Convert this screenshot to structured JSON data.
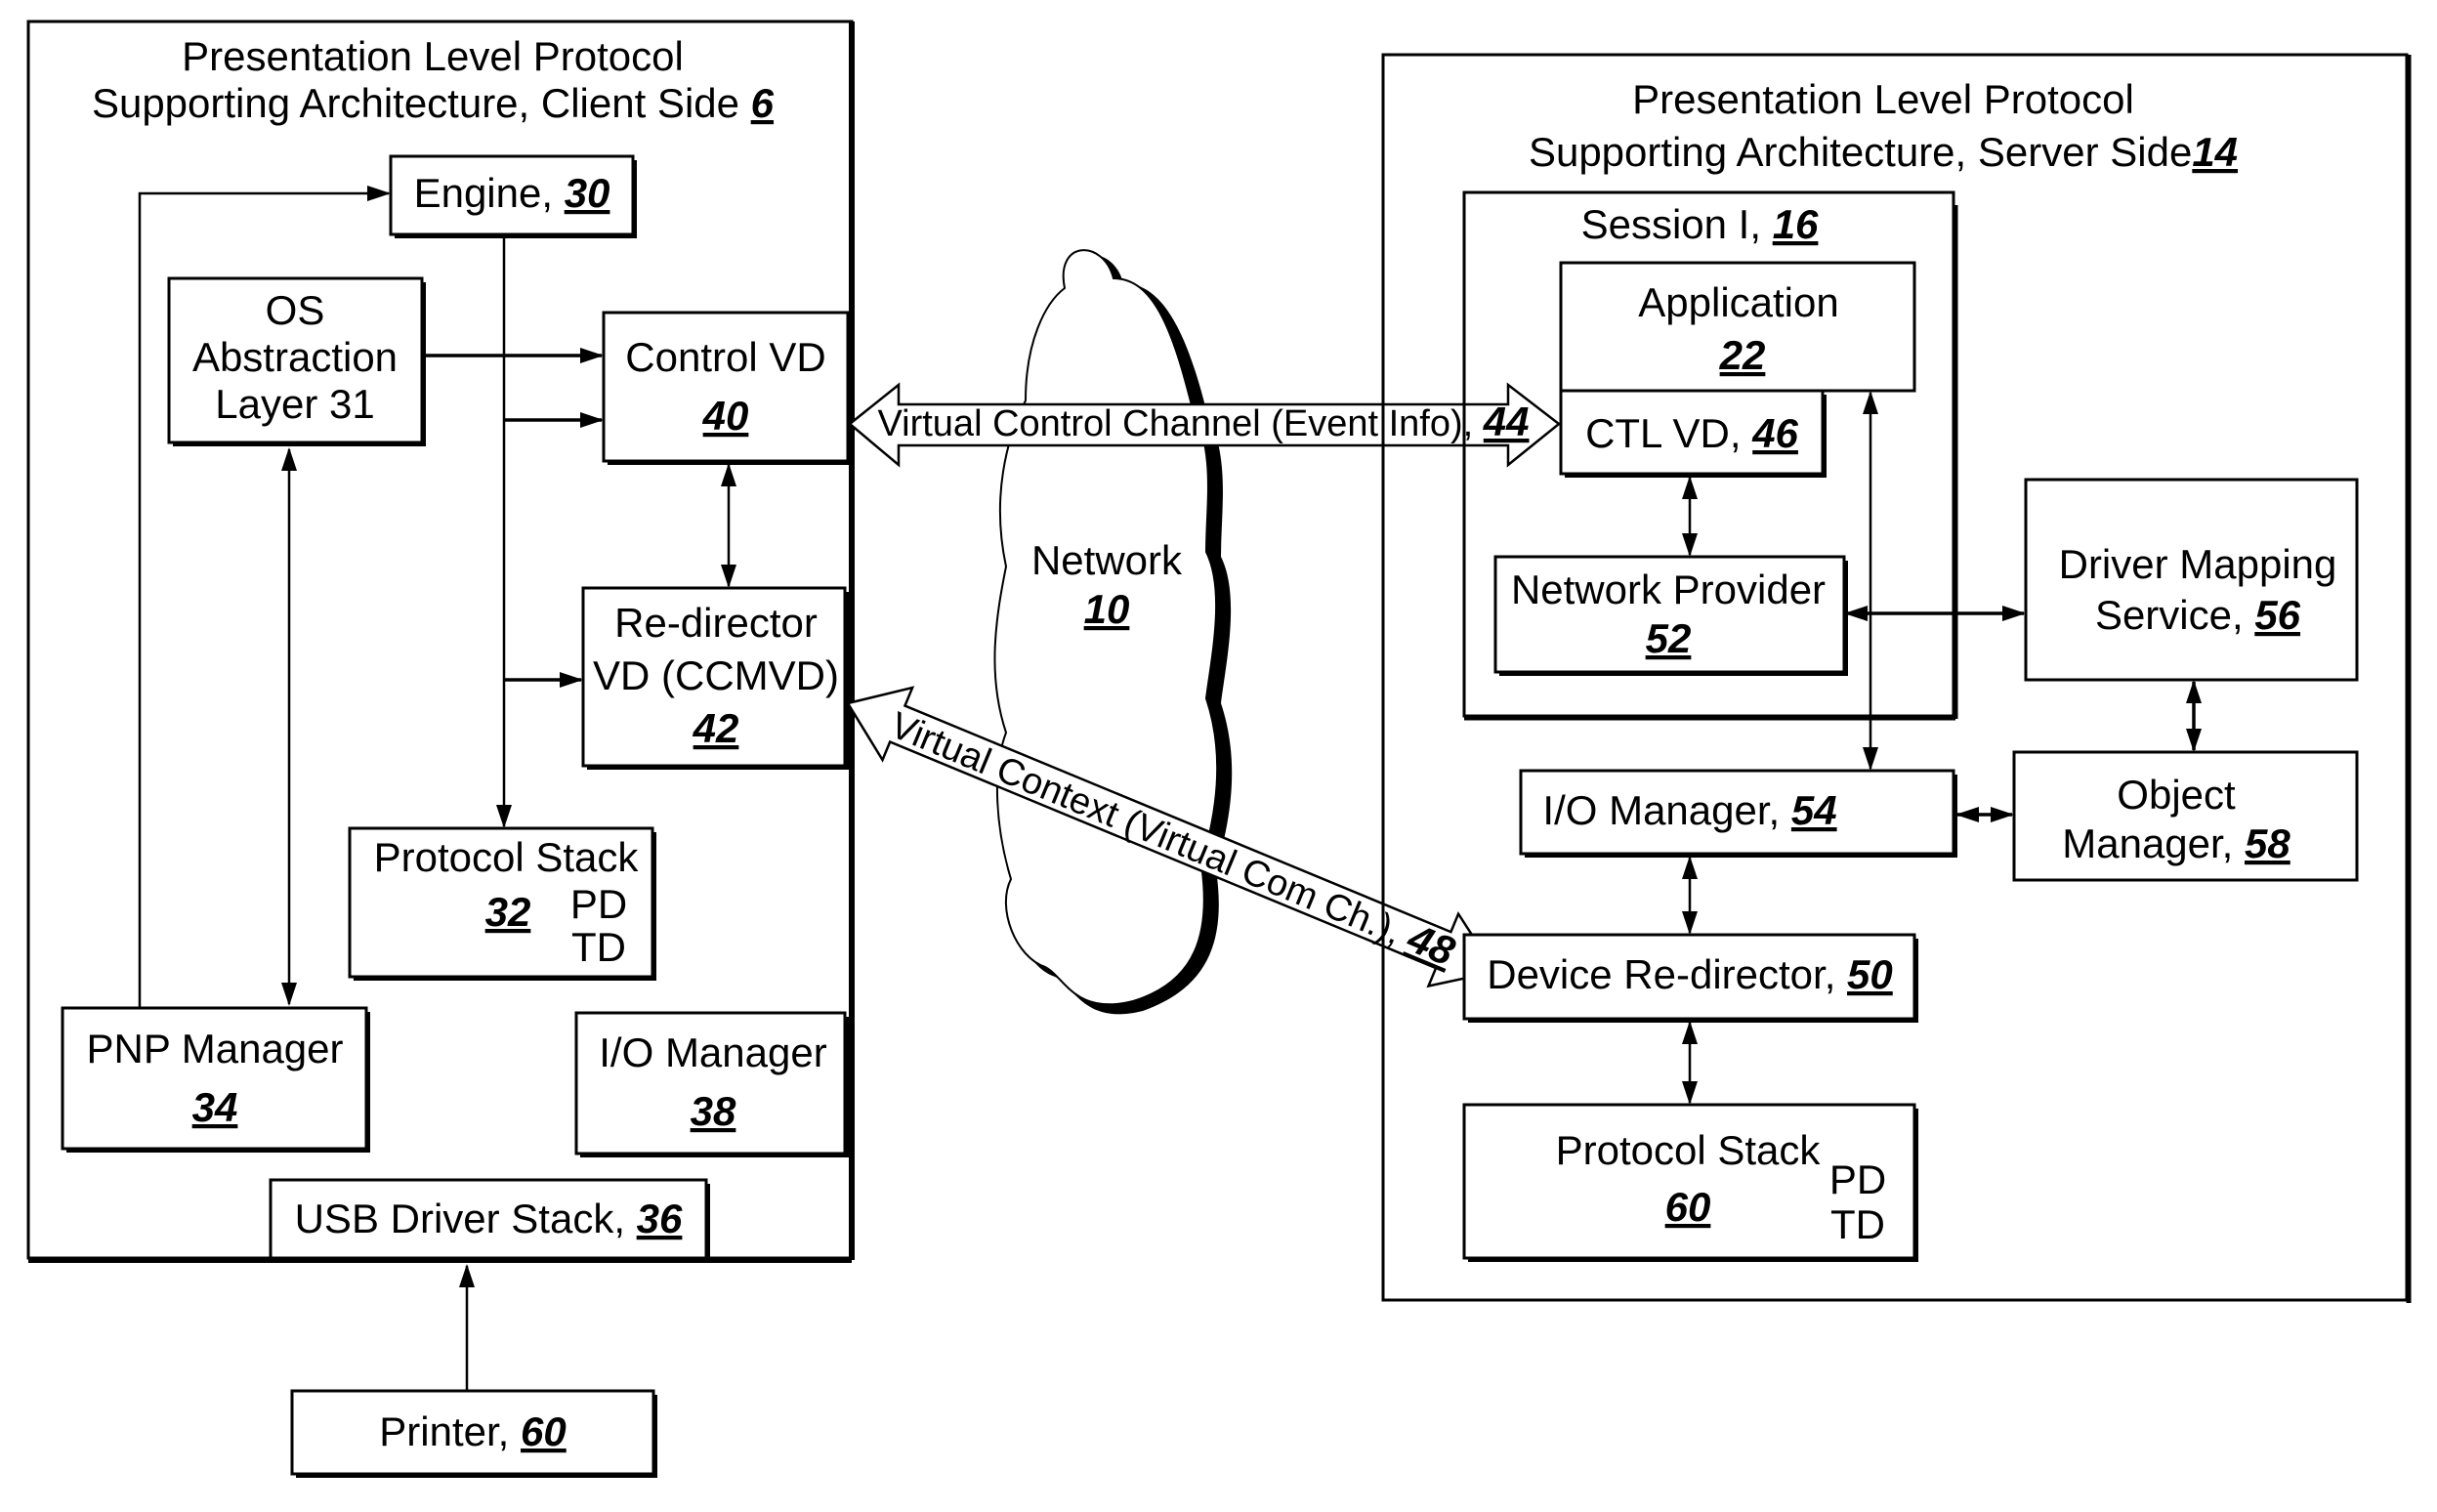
{
  "client": {
    "title_line1": "Presentation Level Protocol",
    "title_line2": "Supporting Architecture, Client Side ",
    "title_ref": "6",
    "engine": {
      "label": "Engine, ",
      "ref": "30"
    },
    "os_abstraction": {
      "line1": "OS",
      "line2": "Abstraction",
      "line3": "Layer 31"
    },
    "control_vd": {
      "label": "Control VD",
      "ref": "40"
    },
    "redirector_vd": {
      "line1": "Re-director",
      "line2": "VD (CCMVD)",
      "ref": "42"
    },
    "protocol_stack": {
      "label": "Protocol Stack",
      "ref": "32",
      "pd": "PD",
      "td": "TD"
    },
    "pnp_manager": {
      "label": "PNP Manager",
      "ref": "34"
    },
    "io_manager": {
      "label": "I/O Manager",
      "ref": "38"
    },
    "usb_driver_stack": {
      "label": "USB Driver Stack, ",
      "ref": "36"
    }
  },
  "printer": {
    "label": "Printer, ",
    "ref": "60"
  },
  "network": {
    "label": "Network",
    "ref": "10"
  },
  "channels": {
    "virtual_control": {
      "label": "Virtual Control Channel (Event Info), ",
      "ref": "44"
    },
    "virtual_context": {
      "label": "Virtual Context (Virtual Com Ch.), ",
      "ref": "48"
    }
  },
  "server": {
    "title_line1": "Presentation Level Protocol",
    "title_line2": "Supporting Architecture, Server Side",
    "title_ref": "14",
    "session": {
      "label": "Session I, ",
      "ref": "16"
    },
    "application": {
      "label": "Application",
      "ref": "22"
    },
    "ctl_vd": {
      "label": "CTL VD, ",
      "ref": "46"
    },
    "network_provider": {
      "label": "Network Provider",
      "ref": "52"
    },
    "driver_mapping": {
      "line1": "Driver Mapping",
      "line2": "Service, ",
      "ref": "56"
    },
    "io_manager": {
      "label": "I/O Manager, ",
      "ref": "54"
    },
    "object_manager": {
      "line1": "Object",
      "line2": "Manager, ",
      "ref": "58"
    },
    "device_redirector": {
      "label": "Device Re-director, ",
      "ref": "50"
    },
    "protocol_stack": {
      "label": "Protocol Stack",
      "ref": "60",
      "pd": "PD",
      "td": "TD"
    }
  }
}
